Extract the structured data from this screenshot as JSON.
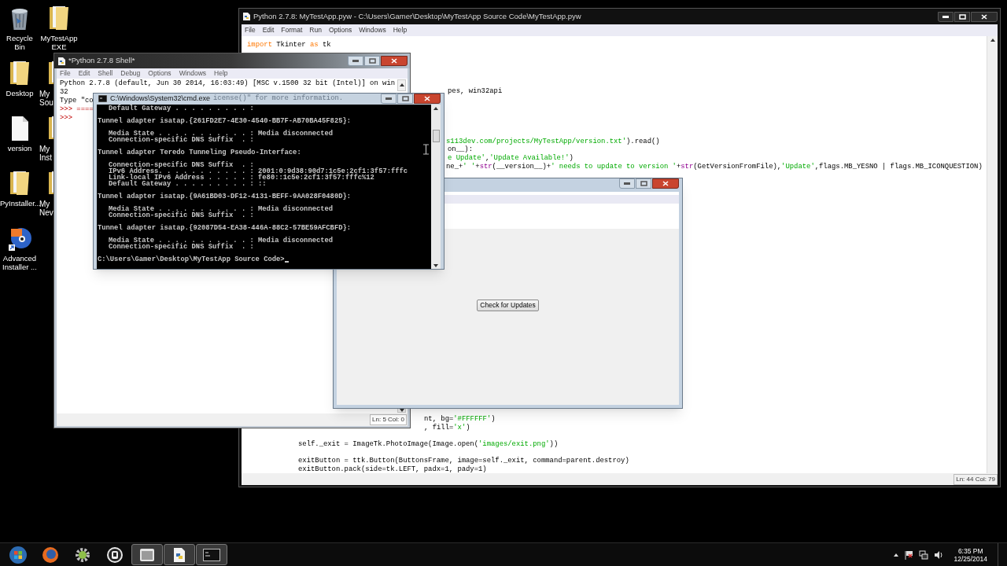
{
  "desktop_icons": [
    {
      "label": "Recycle Bin",
      "kind": "recycle",
      "partial": false
    },
    {
      "label": "MyTestApp EXE",
      "kind": "folder",
      "partial": false
    },
    {
      "label": "Desktop",
      "kind": "folder",
      "partial": false
    },
    {
      "label": "My Sou",
      "kind": "folder",
      "partial": true
    },
    {
      "label": "version",
      "kind": "file",
      "partial": false
    },
    {
      "label": "My Inst",
      "kind": "folder",
      "partial": true
    },
    {
      "label": "PyInstaller...",
      "kind": "folder",
      "partial": false
    },
    {
      "label": "My Nev",
      "kind": "folder",
      "partial": true
    },
    {
      "label": "Advanced Installer ...",
      "kind": "installer",
      "partial": false
    }
  ],
  "editor": {
    "title": "Python 2.7.8: MyTestApp.pyw - C:\\Users\\Gamer\\Desktop\\MyTestApp Source Code\\MyTestApp.pyw",
    "menu": [
      "File",
      "Edit",
      "Format",
      "Run",
      "Options",
      "Windows",
      "Help"
    ],
    "lines": [
      {
        "segments": [
          {
            "text": "import",
            "kind": "keyword"
          },
          {
            "text": " Tkinter ",
            "kind": "plain"
          },
          {
            "text": "as",
            "kind": "keyword"
          },
          {
            "text": " tk",
            "kind": "plain"
          }
        ]
      },
      {
        "segments": [
          {
            "text": "pes, win32api",
            "kind": "plain"
          }
        ]
      },
      {
        "segments": [
          {
            "text": "s113dev.com/projects/MyTestApp/version.txt'",
            "kind": "string"
          },
          {
            "text": ").read()",
            "kind": "plain"
          }
        ]
      },
      {
        "segments": [
          {
            "text": "on__):",
            "kind": "plain"
          }
        ]
      },
      {
        "segments": [
          {
            "text": "e Update'",
            "kind": "string"
          },
          {
            "text": ",",
            "kind": "plain"
          },
          {
            "text": "'Update Available!'",
            "kind": "string"
          },
          {
            "text": ")",
            "kind": "plain"
          }
        ]
      },
      {
        "segments": [
          {
            "text": "ne_+",
            "kind": "plain"
          },
          {
            "text": "' '",
            "kind": "string"
          },
          {
            "text": "+",
            "kind": "plain"
          },
          {
            "text": "str",
            "kind": "builtin"
          },
          {
            "text": "(__version__)+",
            "kind": "plain"
          },
          {
            "text": "' needs to update to version '",
            "kind": "string"
          },
          {
            "text": "+",
            "kind": "plain"
          },
          {
            "text": "str",
            "kind": "builtin"
          },
          {
            "text": "(GetVersionFromFile),",
            "kind": "plain"
          },
          {
            "text": "'Update'",
            "kind": "string"
          },
          {
            "text": ",flags.MB_YESNO | flags.MB_ICONQUESTION)",
            "kind": "plain"
          }
        ]
      },
      {
        "segments": [
          {
            "text": "nt, bg=",
            "kind": "plain"
          },
          {
            "text": "'#FFFFFF'",
            "kind": "string"
          },
          {
            "text": ")",
            "kind": "plain"
          }
        ]
      },
      {
        "segments": [
          {
            "text": ", fill=",
            "kind": "plain"
          },
          {
            "text": "'x'",
            "kind": "string"
          },
          {
            "text": ")",
            "kind": "plain"
          }
        ]
      },
      {
        "segments": [
          {
            "text": "self._exit = ImageTk.PhotoImage(Image.open(",
            "kind": "plain"
          },
          {
            "text": "'images/exit.png'",
            "kind": "string"
          },
          {
            "text": "))",
            "kind": "plain"
          }
        ]
      },
      {
        "segments": [
          {
            "text": "exitButton = ttk.Button(ButtonsFrame, image=self._exit, command=parent.destroy)",
            "kind": "plain"
          }
        ]
      },
      {
        "segments": [
          {
            "text": "exitButton.pack(side=tk.LEFT, padx=1, pady=1)",
            "kind": "plain"
          }
        ]
      }
    ],
    "status": "Ln: 44 Col: 79"
  },
  "shell": {
    "title": "*Python 2.7.8 Shell*",
    "menu": [
      "File",
      "Edit",
      "Shell",
      "Debug",
      "Options",
      "Windows",
      "Help"
    ],
    "lines": [
      {
        "segments": [
          {
            "text": "Python 2.7.8 (default, Jun 30 2014, 16:03:49) [MSC v.1500 32 bit (Intel)] on win",
            "kind": "plain"
          }
        ]
      },
      {
        "segments": [
          {
            "text": "32",
            "kind": "plain"
          }
        ]
      },
      {
        "segments": [
          {
            "text": "Type \"co",
            "kind": "plain"
          }
        ]
      },
      {
        "segments": [
          {
            "text": ">>> ====",
            "kind": "prompt"
          }
        ]
      },
      {
        "segments": [
          {
            "text": ">>>",
            "kind": "prompt"
          }
        ]
      }
    ],
    "status": "Ln: 5 Col: 0"
  },
  "app_window": {
    "button": "Check for Updates"
  },
  "cmd": {
    "title": "C:\\Windows\\System32\\cmd.exe",
    "background_text": "icense()\" for more information.",
    "blocks": [
      {
        "kind": "detail",
        "lines": [
          "Default Gateway . . . . . . . . . :"
        ]
      },
      {
        "kind": "header",
        "lines": [
          "Tunnel adapter isatap.{261FD2E7-4E30-4540-BB7F-AB70BA45F825}:"
        ]
      },
      {
        "kind": "detail",
        "lines": [
          "Media State . . . . . . . . . . . : Media disconnected",
          "Connection-specific DNS Suffix  . :"
        ]
      },
      {
        "kind": "header",
        "lines": [
          "Tunnel adapter Teredo Tunneling Pseudo-Interface:"
        ]
      },
      {
        "kind": "detail",
        "lines": [
          "Connection-specific DNS Suffix  . :",
          "IPv6 Address. . . . . . . . . . . : 2001:0:9d38:90d7:1c5e:2cf1:3f57:fffc",
          "Link-local IPv6 Address . . . . . : fe80::1c5e:2cf1:3f57:fffc%12",
          "Default Gateway . . . . . . . . . : ::"
        ]
      },
      {
        "kind": "header",
        "lines": [
          "Tunnel adapter isatap.{9A61BD03-DF12-4131-BEFF-9AA028F0480D}:"
        ]
      },
      {
        "kind": "detail",
        "lines": [
          "Media State . . . . . . . . . . . : Media disconnected",
          "Connection-specific DNS Suffix  . :"
        ]
      },
      {
        "kind": "header",
        "lines": [
          "Tunnel adapter isatap.{92087D54-EA38-446A-88C2-57BE59AFCBFD}:"
        ]
      },
      {
        "kind": "detail",
        "lines": [
          "Media State . . . . . . . . . . . : Media disconnected",
          "Connection-specific DNS Suffix  . :"
        ]
      },
      {
        "kind": "prompt",
        "lines": [
          "C:\\Users\\Gamer\\Desktop\\MyTestApp Source Code>"
        ]
      }
    ]
  },
  "taskbar": {
    "apps": [
      {
        "kind": "start",
        "open": false
      },
      {
        "kind": "browser",
        "open": false
      },
      {
        "kind": "gear",
        "open": false
      },
      {
        "kind": "emblem",
        "open": false
      },
      {
        "kind": "window",
        "open": true
      },
      {
        "kind": "document",
        "open": true
      },
      {
        "kind": "terminal",
        "open": true
      }
    ],
    "clock": {
      "time": "6:35 PM",
      "date": "12/25/2014"
    }
  }
}
